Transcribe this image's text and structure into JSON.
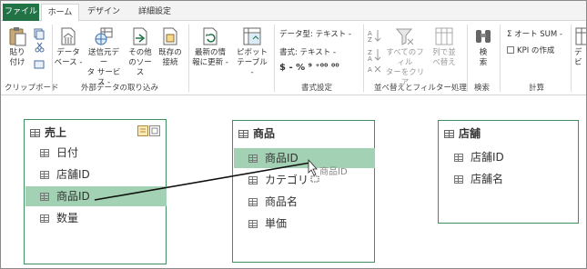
{
  "tabs": {
    "file": "ファイル",
    "home": "ホーム",
    "design": "デザイン",
    "advanced": "詳細設定"
  },
  "ribbon": {
    "clipboard": {
      "paste_line1": "貼り",
      "paste_line2": "付け",
      "group": "クリップボード"
    },
    "external": {
      "database_line1": "データ",
      "database_line2": "ベース -",
      "data_service_line1": "送信元デー",
      "data_service_line2": "タ サービス -",
      "other_line1": "その他",
      "other_line2": "のソース",
      "existing_line1": "既存の",
      "existing_line2": "接続",
      "group": "外部データの取り込み"
    },
    "refresh": {
      "line1": "最新の情",
      "line2": "報に更新 -"
    },
    "pivot": {
      "line1": "ピボット",
      "line2": "テーブル -"
    },
    "format": {
      "data_type": "データ型: テキスト -",
      "format": "書式: テキスト -",
      "symbols": "$ - % ⁹ ⁺⁰⁰ ⁰⁰",
      "group": "書式設定"
    },
    "sort": {
      "clear_line1": "すべてのフィル",
      "clear_line2": "ターをクリア",
      "col_line1": "列で並",
      "col_line2": "べ替え",
      "group": "並べ替えとフィルター処理"
    },
    "find": {
      "line1": "検",
      "line2": "索",
      "group": "検索"
    },
    "calc": {
      "autosum": "Σ オート SUM -",
      "kpi": "KPI の作成",
      "group": "計算"
    },
    "view": {
      "line1": "デ",
      "line2": "ビ"
    }
  },
  "tables": {
    "sales": {
      "title": "売上",
      "fields": [
        "日付",
        "店舗ID",
        "商品ID",
        "数量"
      ]
    },
    "products": {
      "title": "商品",
      "fields": [
        "商品ID",
        "カテゴリ",
        "商品名",
        "単価"
      ]
    },
    "stores": {
      "title": "店舗",
      "fields": [
        "店舗ID",
        "店舗名"
      ]
    }
  },
  "drag_ghost": "商品ID",
  "colors": {
    "accent": "#217346",
    "selection": "#a3d1b3",
    "card_border": "#3f8f5f"
  }
}
